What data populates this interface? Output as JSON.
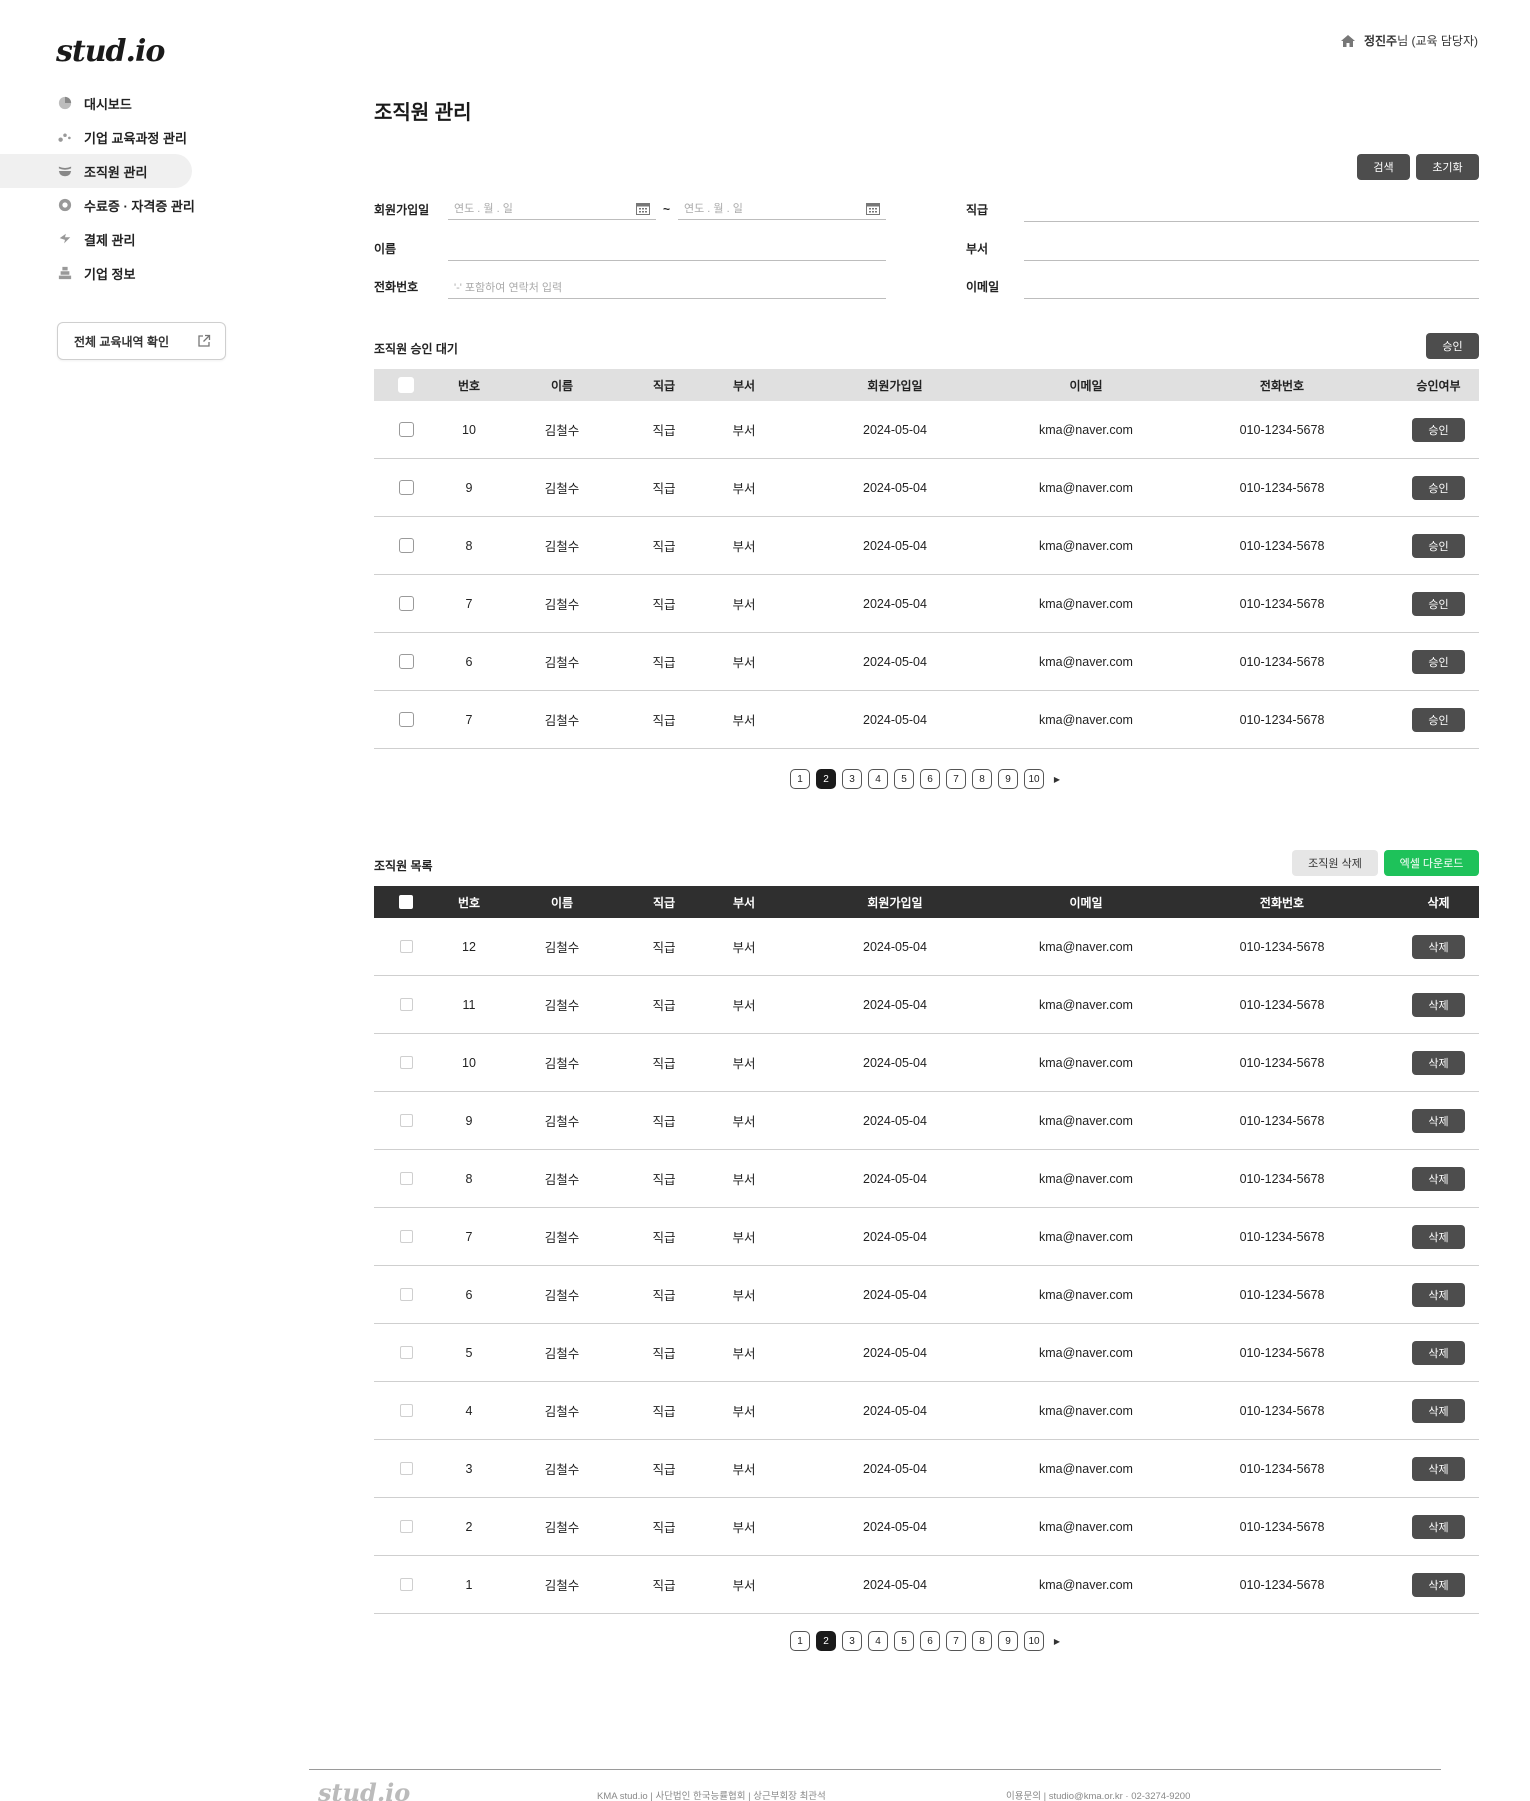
{
  "brand": {
    "logo": "stud.io"
  },
  "user": {
    "name": "정진주",
    "suffix": "님 (교육 담당자)"
  },
  "sidebar": {
    "items": [
      {
        "label": "대시보드",
        "icon": "pie-chart-icon"
      },
      {
        "label": "기업 교육과정 관리",
        "icon": "dots-icon"
      },
      {
        "label": "조직원 관리",
        "icon": "users-icon",
        "active": true
      },
      {
        "label": "수료증 · 자격증 관리",
        "icon": "badge-icon"
      },
      {
        "label": "결제 관리",
        "icon": "lightning-icon"
      },
      {
        "label": "기업 정보",
        "icon": "building-icon"
      }
    ],
    "history_button": "전체 교육내역 확인"
  },
  "page": {
    "title": "조직원 관리"
  },
  "filters": {
    "search_label": "검색",
    "reset_label": "초기화",
    "join_date_label": "회원가입일",
    "date_placeholder_from": "연도 . 월 . 일",
    "date_separator": "~",
    "date_placeholder_to": "연도 . 월 . 일",
    "name_label": "이름",
    "phone_label": "전화번호",
    "phone_placeholder": "'-' 포함하여 연락처 입력",
    "rank_label": "직급",
    "dept_label": "부서",
    "email_label": "이메일"
  },
  "pending": {
    "title": "조직원 승인 대기",
    "approve_button": "승인",
    "columns": [
      "번호",
      "이름",
      "직급",
      "부서",
      "회원가입일",
      "이메일",
      "전화번호",
      "승인여부"
    ],
    "row_button": "승인",
    "rows": [
      {
        "no": "10",
        "name": "김철수",
        "rank": "직급",
        "dept": "부서",
        "date": "2024-05-04",
        "email": "kma@naver.com",
        "phone": "010-1234-5678"
      },
      {
        "no": "9",
        "name": "김철수",
        "rank": "직급",
        "dept": "부서",
        "date": "2024-05-04",
        "email": "kma@naver.com",
        "phone": "010-1234-5678"
      },
      {
        "no": "8",
        "name": "김철수",
        "rank": "직급",
        "dept": "부서",
        "date": "2024-05-04",
        "email": "kma@naver.com",
        "phone": "010-1234-5678"
      },
      {
        "no": "7",
        "name": "김철수",
        "rank": "직급",
        "dept": "부서",
        "date": "2024-05-04",
        "email": "kma@naver.com",
        "phone": "010-1234-5678"
      },
      {
        "no": "6",
        "name": "김철수",
        "rank": "직급",
        "dept": "부서",
        "date": "2024-05-04",
        "email": "kma@naver.com",
        "phone": "010-1234-5678"
      },
      {
        "no": "7",
        "name": "김철수",
        "rank": "직급",
        "dept": "부서",
        "date": "2024-05-04",
        "email": "kma@naver.com",
        "phone": "010-1234-5678"
      }
    ],
    "pages": [
      "1",
      "2",
      "3",
      "4",
      "5",
      "6",
      "7",
      "8",
      "9",
      "10"
    ],
    "current_page": "2"
  },
  "members": {
    "title": "조직원 목록",
    "delete_members_button": "조직원 삭제",
    "excel_button": "엑셀 다운로드",
    "columns": [
      "번호",
      "이름",
      "직급",
      "부서",
      "회원가입일",
      "이메일",
      "전화번호",
      "삭제"
    ],
    "row_button": "삭제",
    "rows": [
      {
        "no": "12",
        "name": "김철수",
        "rank": "직급",
        "dept": "부서",
        "date": "2024-05-04",
        "email": "kma@naver.com",
        "phone": "010-1234-5678"
      },
      {
        "no": "11",
        "name": "김철수",
        "rank": "직급",
        "dept": "부서",
        "date": "2024-05-04",
        "email": "kma@naver.com",
        "phone": "010-1234-5678"
      },
      {
        "no": "10",
        "name": "김철수",
        "rank": "직급",
        "dept": "부서",
        "date": "2024-05-04",
        "email": "kma@naver.com",
        "phone": "010-1234-5678"
      },
      {
        "no": "9",
        "name": "김철수",
        "rank": "직급",
        "dept": "부서",
        "date": "2024-05-04",
        "email": "kma@naver.com",
        "phone": "010-1234-5678"
      },
      {
        "no": "8",
        "name": "김철수",
        "rank": "직급",
        "dept": "부서",
        "date": "2024-05-04",
        "email": "kma@naver.com",
        "phone": "010-1234-5678"
      },
      {
        "no": "7",
        "name": "김철수",
        "rank": "직급",
        "dept": "부서",
        "date": "2024-05-04",
        "email": "kma@naver.com",
        "phone": "010-1234-5678"
      },
      {
        "no": "6",
        "name": "김철수",
        "rank": "직급",
        "dept": "부서",
        "date": "2024-05-04",
        "email": "kma@naver.com",
        "phone": "010-1234-5678"
      },
      {
        "no": "5",
        "name": "김철수",
        "rank": "직급",
        "dept": "부서",
        "date": "2024-05-04",
        "email": "kma@naver.com",
        "phone": "010-1234-5678"
      },
      {
        "no": "4",
        "name": "김철수",
        "rank": "직급",
        "dept": "부서",
        "date": "2024-05-04",
        "email": "kma@naver.com",
        "phone": "010-1234-5678"
      },
      {
        "no": "3",
        "name": "김철수",
        "rank": "직급",
        "dept": "부서",
        "date": "2024-05-04",
        "email": "kma@naver.com",
        "phone": "010-1234-5678"
      },
      {
        "no": "2",
        "name": "김철수",
        "rank": "직급",
        "dept": "부서",
        "date": "2024-05-04",
        "email": "kma@naver.com",
        "phone": "010-1234-5678"
      },
      {
        "no": "1",
        "name": "김철수",
        "rank": "직급",
        "dept": "부서",
        "date": "2024-05-04",
        "email": "kma@naver.com",
        "phone": "010-1234-5678"
      }
    ],
    "pages": [
      "1",
      "2",
      "3",
      "4",
      "5",
      "6",
      "7",
      "8",
      "9",
      "10"
    ],
    "current_page": "2"
  },
  "footer": {
    "logo": "stud.io",
    "org_info": "KMA stud.io  |  사단법인 한국능률협회  |  상근부회장 최관석",
    "contact": "이용문의  |  studio@kma.or.kr · 02-3274-9200"
  },
  "colors": {
    "accent_green": "#1ec25a",
    "dark_button": "#4d4d4d",
    "header_black": "#2f2f2f",
    "header_gray": "#e0e0e0"
  }
}
